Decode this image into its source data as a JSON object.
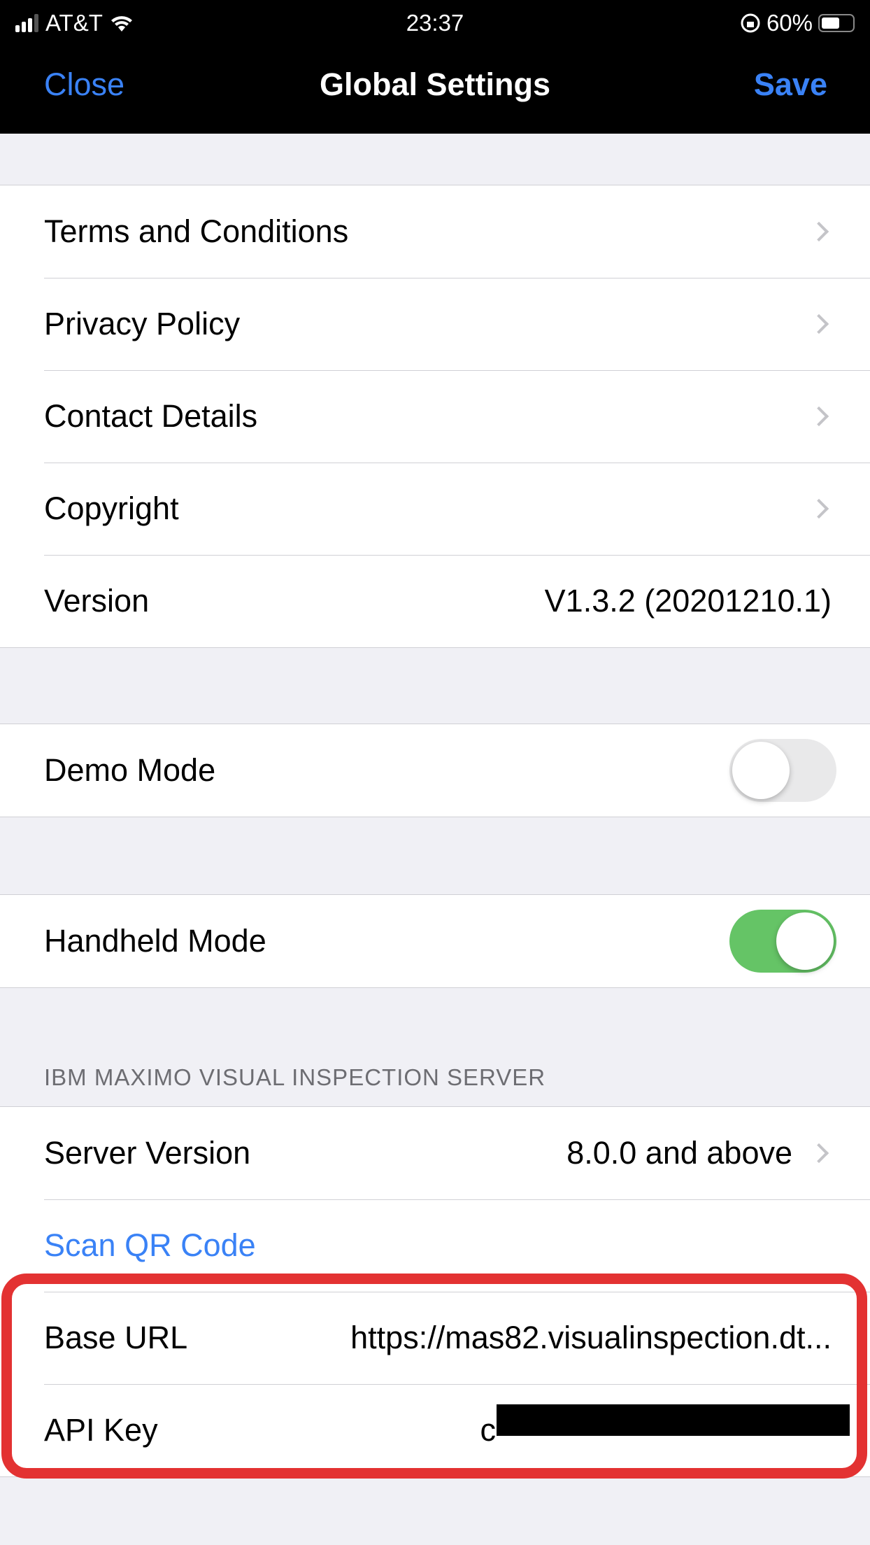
{
  "status_bar": {
    "carrier": "AT&T",
    "time": "23:37",
    "battery": "60%"
  },
  "nav": {
    "close": "Close",
    "title": "Global Settings",
    "save": "Save"
  },
  "info_rows": [
    {
      "label": "Terms and Conditions"
    },
    {
      "label": "Privacy Policy"
    },
    {
      "label": "Contact Details"
    },
    {
      "label": "Copyright"
    },
    {
      "label": "Version",
      "value": "V1.3.2 (20201210.1)"
    }
  ],
  "demo_mode": {
    "label": "Demo Mode",
    "on": false
  },
  "handheld_mode": {
    "label": "Handheld Mode",
    "on": true
  },
  "server": {
    "header": "IBM MAXIMO VISUAL INSPECTION SERVER",
    "server_version_label": "Server Version",
    "server_version_value": "8.0.0 and above",
    "scan_qr": "Scan QR Code",
    "base_url_label": "Base URL",
    "base_url_value": "https://mas82.visualinspection.dt...",
    "api_key_label": "API Key",
    "api_key_value": "c"
  }
}
